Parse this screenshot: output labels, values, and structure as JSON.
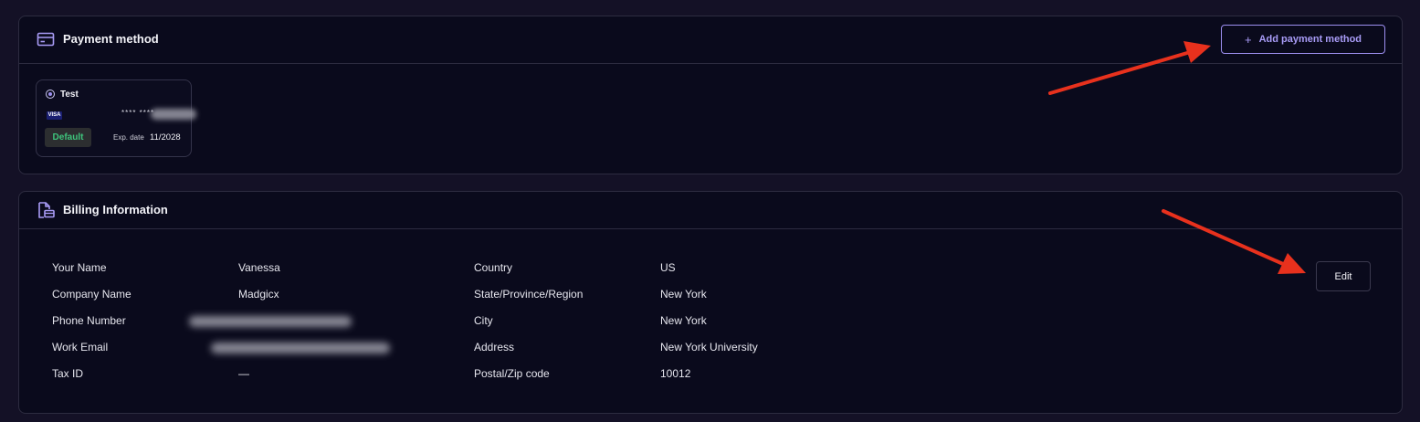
{
  "payment": {
    "title": "Payment method",
    "icon": "credit-card-icon",
    "add_button": {
      "icon": "plus-icon",
      "label": "Add payment method"
    },
    "card": {
      "name": "Test",
      "brand": "VISA",
      "number_masked": "**** ****",
      "badge": "Default",
      "exp_label": "Exp. date",
      "exp_value": "11/2028"
    }
  },
  "billing": {
    "title": "Billing Information",
    "icon": "document-card-icon",
    "edit_label": "Edit",
    "left_fields": [
      {
        "label": "Your Name",
        "value": "Vanessa"
      },
      {
        "label": "Company Name",
        "value": "Madgicx"
      },
      {
        "label": "Phone Number",
        "value": ""
      },
      {
        "label": "Work Email",
        "value": ""
      },
      {
        "label": "Tax ID",
        "value": "—"
      }
    ],
    "right_fields": [
      {
        "label": "Country",
        "value": "US"
      },
      {
        "label": "State/Province/Region",
        "value": "New York"
      },
      {
        "label": "City",
        "value": "New York"
      },
      {
        "label": "Address",
        "value": "New York University"
      },
      {
        "label": "Postal/Zip code",
        "value": "10012"
      }
    ]
  },
  "colors": {
    "page_bg": "#141126",
    "panel_bg": "#0a0a1c",
    "accent": "#9d8ff0",
    "default_green": "#3ec47c",
    "annotation_red": "#e8311d"
  }
}
